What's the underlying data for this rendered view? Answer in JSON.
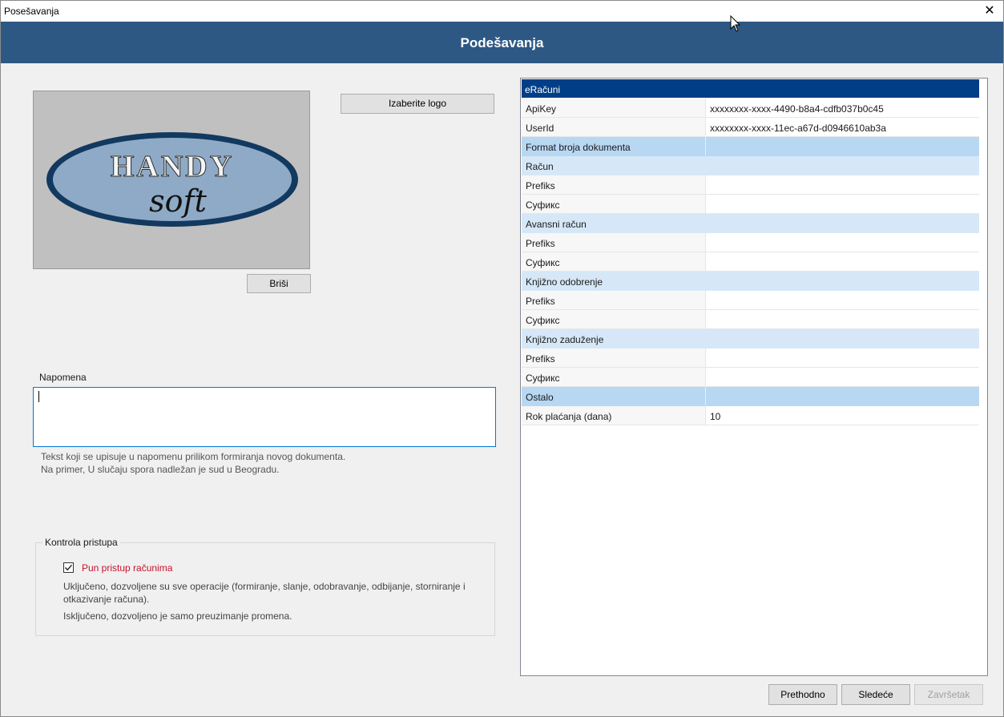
{
  "window": {
    "title": "Posešavanja",
    "close_glyph": "✕"
  },
  "header": {
    "title": "Podešavanja"
  },
  "logo": {
    "image_text_line1": "HANDY",
    "image_text_line2": "soft",
    "choose_button": "Izaberite logo",
    "delete_button": "Briši"
  },
  "note": {
    "label": "Napomena",
    "value": "",
    "hint_line1": "Tekst koji se upisuje u napomenu prilikom  formiranja novog dokumenta.",
    "hint_line2": "Na primer, U slučaju spora nadležan je sud u Beogradu."
  },
  "access": {
    "group_title": "Kontrola pristupa",
    "checkbox_label": "Pun pristup računima",
    "checked": true,
    "description_on": "Uključeno, dozvoljene su sve operacije (formiranje, slanje, odobravanje, odbijanje, storniranje i otkazivanje računa).",
    "description_off": "Isključeno, dozvoljeno je samo preuzimanje promena."
  },
  "grid": {
    "header": "eRačuni",
    "rows": [
      {
        "kind": "normal",
        "key": "ApiKey",
        "value": "xxxxxxxx-xxxx-4490-b8a4-cdfb037b0c45"
      },
      {
        "kind": "normal",
        "key": "UserId",
        "value": "xxxxxxxx-xxxx-11ec-a67d-d0946610ab3a"
      },
      {
        "kind": "section",
        "key": "Format broja dokumenta",
        "value": ""
      },
      {
        "kind": "sub",
        "key": "Račun",
        "value": ""
      },
      {
        "kind": "normal",
        "key": "Prefiks",
        "value": ""
      },
      {
        "kind": "normal",
        "key": "Суфикс",
        "value": ""
      },
      {
        "kind": "sub",
        "key": "Avansni račun",
        "value": ""
      },
      {
        "kind": "normal",
        "key": "Prefiks",
        "value": ""
      },
      {
        "kind": "normal",
        "key": "Суфикс",
        "value": ""
      },
      {
        "kind": "sub",
        "key": "Knjižno odobrenje",
        "value": ""
      },
      {
        "kind": "normal",
        "key": "Prefiks",
        "value": ""
      },
      {
        "kind": "normal",
        "key": "Суфикс",
        "value": ""
      },
      {
        "kind": "sub",
        "key": "Knjižno zaduženje",
        "value": ""
      },
      {
        "kind": "normal",
        "key": "Prefiks",
        "value": ""
      },
      {
        "kind": "normal",
        "key": "Суфикс",
        "value": ""
      },
      {
        "kind": "section",
        "key": "Ostalo",
        "value": ""
      },
      {
        "kind": "normal",
        "key": "Rok plaćanja (dana)",
        "value": "10"
      }
    ]
  },
  "footer": {
    "prev_button": "Prethodno",
    "next_button": "Sledeće",
    "finish_button": "Završetak"
  },
  "colors": {
    "header_bg": "#2e5884",
    "grid_header_bg": "#003f87",
    "section_bg": "#b8d7f2",
    "subsection_bg": "#d6e8f7",
    "checkbox_label": "#c8102e"
  }
}
